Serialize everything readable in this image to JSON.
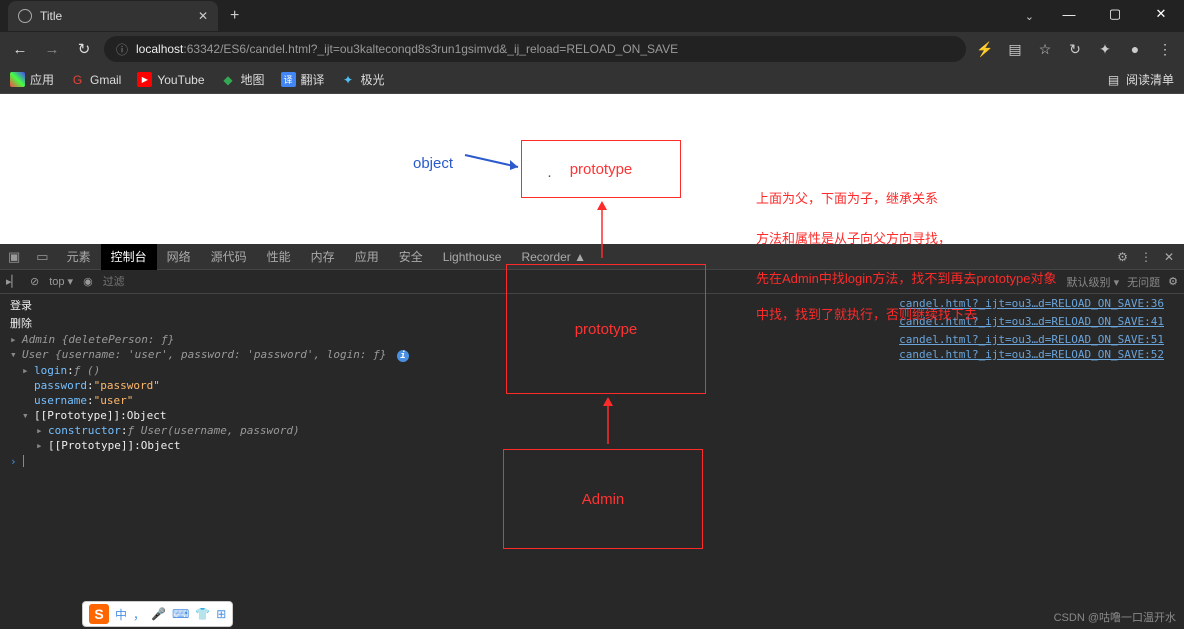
{
  "window": {
    "min": "—",
    "max": "▢",
    "close": "✕",
    "dropdown": "⌄"
  },
  "tab": {
    "title": "Title",
    "close": "✕",
    "new": "+"
  },
  "nav": {
    "back": "←",
    "forward": "→",
    "reload": "↻"
  },
  "url": {
    "info": "ⓘ",
    "host": "localhost",
    "port": ":63342",
    "path": "/ES6/candel.html?_ijt=ou3kalteconqd8s3run1gsimvd&_ij_reload=RELOAD_ON_SAVE"
  },
  "addr_icons": {
    "translate": "⚡",
    "reader": "▤",
    "bookmark": "☆",
    "update": "↻",
    "ext": "✦",
    "profile": "●",
    "menu": "⋮"
  },
  "bookmarks": {
    "apps": "应用",
    "gmail": "Gmail",
    "youtube": "YouTube",
    "maps": "地图",
    "translate": "翻译",
    "jiguang": "极光",
    "reading_list": "阅读清单"
  },
  "diagram": {
    "box1": "prototype",
    "box2": "prototype",
    "box3": "Admin",
    "object_label": "object"
  },
  "annotations": {
    "l1": "上面为父，下面为子，继承关系",
    "l2": "方法和属性是从子向父方向寻找，",
    "l3": "先在Admin中找login方法，找不到再去prototype对象",
    "l4": "中找，找到了就执行，否则继续找下去"
  },
  "devtools": {
    "tabs": [
      "元素",
      "控制台",
      "网络",
      "源代码",
      "性能",
      "内存",
      "应用",
      "安全",
      "Lighthouse",
      "Recorder ▲"
    ],
    "filter_top": "top ▾",
    "filter_placeholder": "过滤",
    "filter_right_a": "默认级别 ▾",
    "filter_right_b": "无问题"
  },
  "console": {
    "line1": "登录",
    "line2": "删除",
    "admin_obj": {
      "pre": "Admin ",
      "brace": "{",
      "key": "deletePerson",
      "colon": ": ",
      "val": "ƒ",
      "close": "}"
    },
    "user_obj": {
      "pre": "User ",
      "brace": "{",
      "k1": "username",
      "v1": "'user'",
      "k2": "password",
      "v2": "'password'",
      "k3": "login",
      "v3": "ƒ",
      "close": "}"
    },
    "login": {
      "key": "login",
      "val": "ƒ ()"
    },
    "password": {
      "key": "password",
      "val": "\"password\""
    },
    "username": {
      "key": "username",
      "val": "\"user\""
    },
    "proto1": {
      "key": "[[Prototype]]",
      "val": "Object"
    },
    "constructor": {
      "key": "constructor",
      "val": "ƒ User(username, password)"
    },
    "proto2": {
      "key": "[[Prototype]]",
      "val": "Object"
    },
    "links": {
      "l1": "candel.html?_ijt=ou3…d=RELOAD_ON_SAVE:36",
      "l2": "candel.html?_ijt=ou3…d=RELOAD_ON_SAVE:41",
      "l3": "candel.html?_ijt=ou3…d=RELOAD_ON_SAVE:51",
      "l4": "candel.html?_ijt=ou3…d=RELOAD_ON_SAVE:52"
    }
  },
  "ime": {
    "logo": "S",
    "zhong": "中",
    "sep": "，"
  },
  "watermark": "CSDN @咕噜一口温开水"
}
